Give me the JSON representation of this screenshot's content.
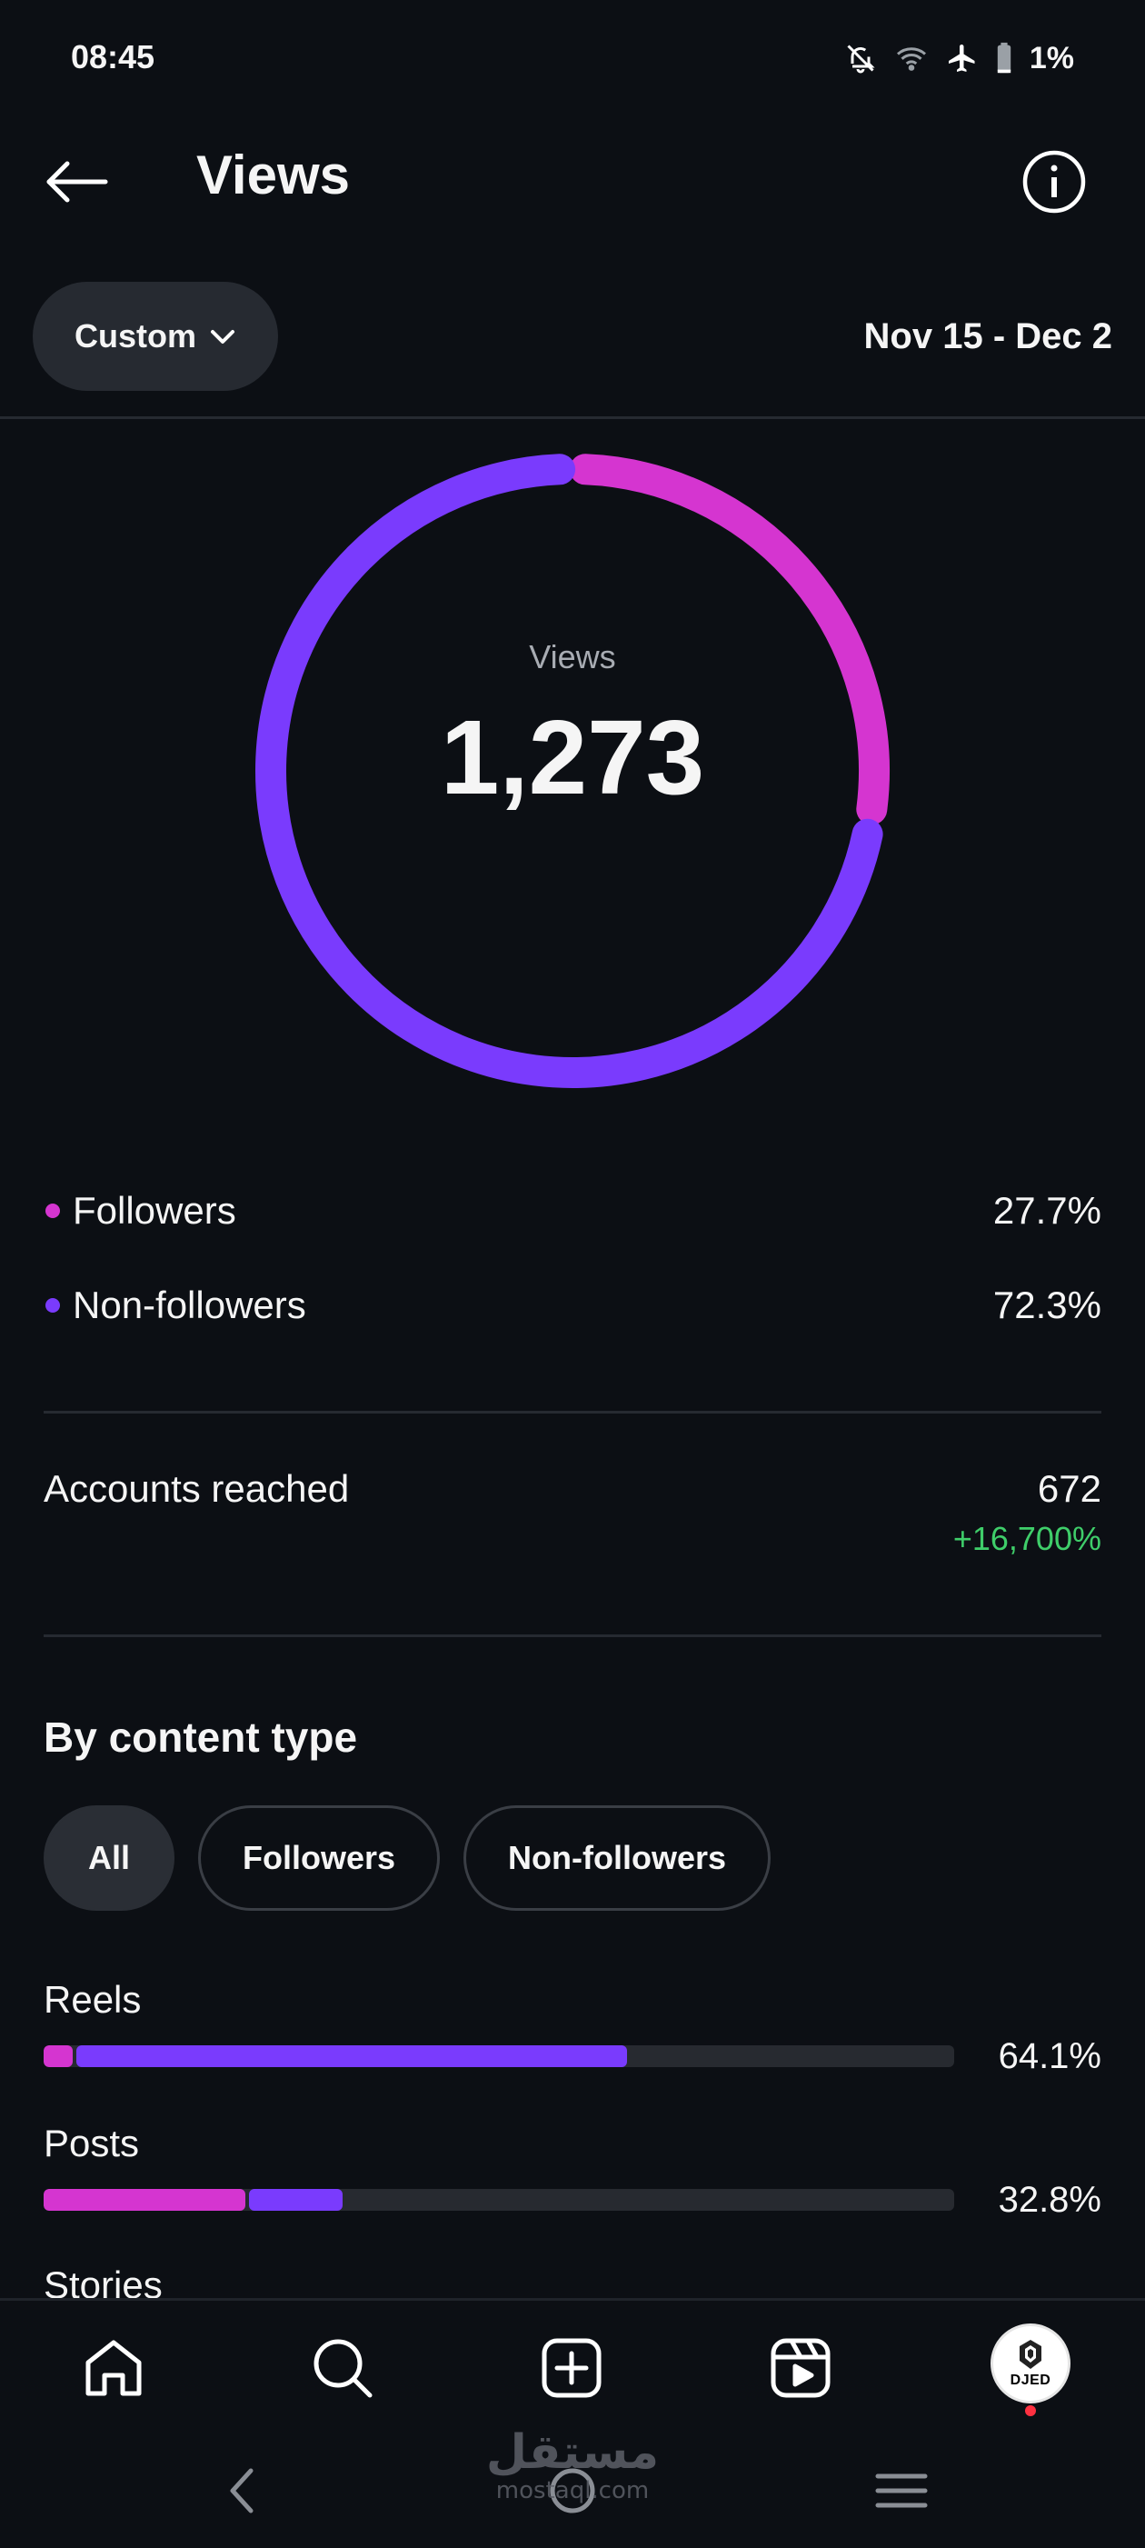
{
  "status_bar": {
    "time": "08:45",
    "battery": "1%"
  },
  "header": {
    "title": "Views"
  },
  "filter": {
    "range_label": "Custom",
    "date_range": "Nov 15 - Dec 2"
  },
  "views": {
    "label": "Views",
    "total": "1,273"
  },
  "chart_data": {
    "type": "pie",
    "categories": [
      "Followers",
      "Non-followers"
    ],
    "values": [
      27.7,
      72.3
    ],
    "colors": [
      "#d535d0",
      "#7a3bfd"
    ]
  },
  "audience": [
    {
      "label": "Followers",
      "pct": "27.7%",
      "color": "#d535d0"
    },
    {
      "label": "Non-followers",
      "pct": "72.3%",
      "color": "#7a3bfd"
    }
  ],
  "accounts_reached": {
    "label": "Accounts reached",
    "value": "672",
    "change": "+16,700%"
  },
  "content_type": {
    "title": "By content type",
    "chips": [
      {
        "label": "All",
        "active": true
      },
      {
        "label": "Followers",
        "active": false
      },
      {
        "label": "Non-followers",
        "active": false
      }
    ],
    "rows": [
      {
        "label": "Reels",
        "pct": "64.1%",
        "followers_share": 3.2,
        "non_followers_share": 60.9
      },
      {
        "label": "Posts",
        "pct": "32.8%",
        "followers_share": 22.2,
        "non_followers_share": 10.6
      },
      {
        "label": "Stories"
      }
    ]
  },
  "bottom_nav": {
    "items": [
      "home-icon",
      "search-icon",
      "create-icon",
      "reels-icon",
      "profile-avatar"
    ],
    "avatar_text": "DJED"
  },
  "watermark": {
    "arabic": "مستقل",
    "latin": "mostaql.com"
  }
}
